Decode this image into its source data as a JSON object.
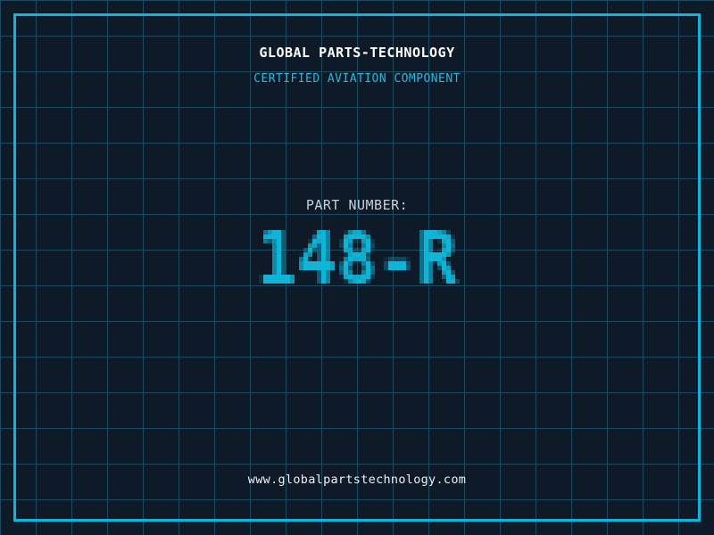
{
  "header": {
    "title": "GLOBAL PARTS-TECHNOLOGY",
    "subtitle": "CERTIFIED AVIATION COMPONENT"
  },
  "part": {
    "label": "PART NUMBER:",
    "number": "148-R"
  },
  "footer": {
    "url": "www.globalpartstechnology.com"
  },
  "colors": {
    "background": "#0f1a28",
    "grid_line": "#1b4a5e",
    "frame": "#0cb6da",
    "title_text": "#ffffff",
    "subtitle_text": "#2cb6da",
    "part_label_text": "#c9cfda",
    "part_number_text": "#10b4d6",
    "url_text": "#eff1f5"
  }
}
